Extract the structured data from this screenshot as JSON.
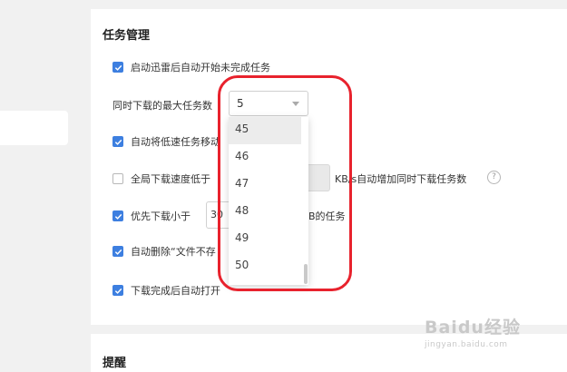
{
  "section": {
    "title": "任务管理"
  },
  "options": {
    "auto_start": {
      "label": "启动迅雷后自动开始未完成任务",
      "checked": true
    },
    "max_tasks": {
      "label": "同时下载的最大任务数",
      "value": "5"
    },
    "move_slow": {
      "label": "自动将低速任务移动",
      "checked": true
    },
    "global_speed": {
      "label": "全局下载速度低于",
      "suffix": "KB/s自动增加同时下载任务数",
      "checked": false
    },
    "priority_small": {
      "label": "优先下载小于",
      "value": "30",
      "suffix": "B的任务",
      "checked": true
    },
    "auto_delete": {
      "label": "自动删除“文件不存",
      "checked": true
    },
    "auto_open": {
      "label": "下载完成后自动打开",
      "checked": true
    }
  },
  "dropdown": {
    "options": [
      "45",
      "46",
      "47",
      "48",
      "49",
      "50"
    ],
    "highlighted": "45"
  },
  "section2": {
    "title": "提醒"
  },
  "icons": {
    "checkbox_checked": "check-icon",
    "help": "question-circle-icon",
    "caret": "chevron-down-icon"
  },
  "colors": {
    "accent": "#3d7fe0",
    "annotation": "#e8222d"
  },
  "watermark": {
    "brand": "Baidu经验",
    "url": "jingyan.baidu.com"
  }
}
